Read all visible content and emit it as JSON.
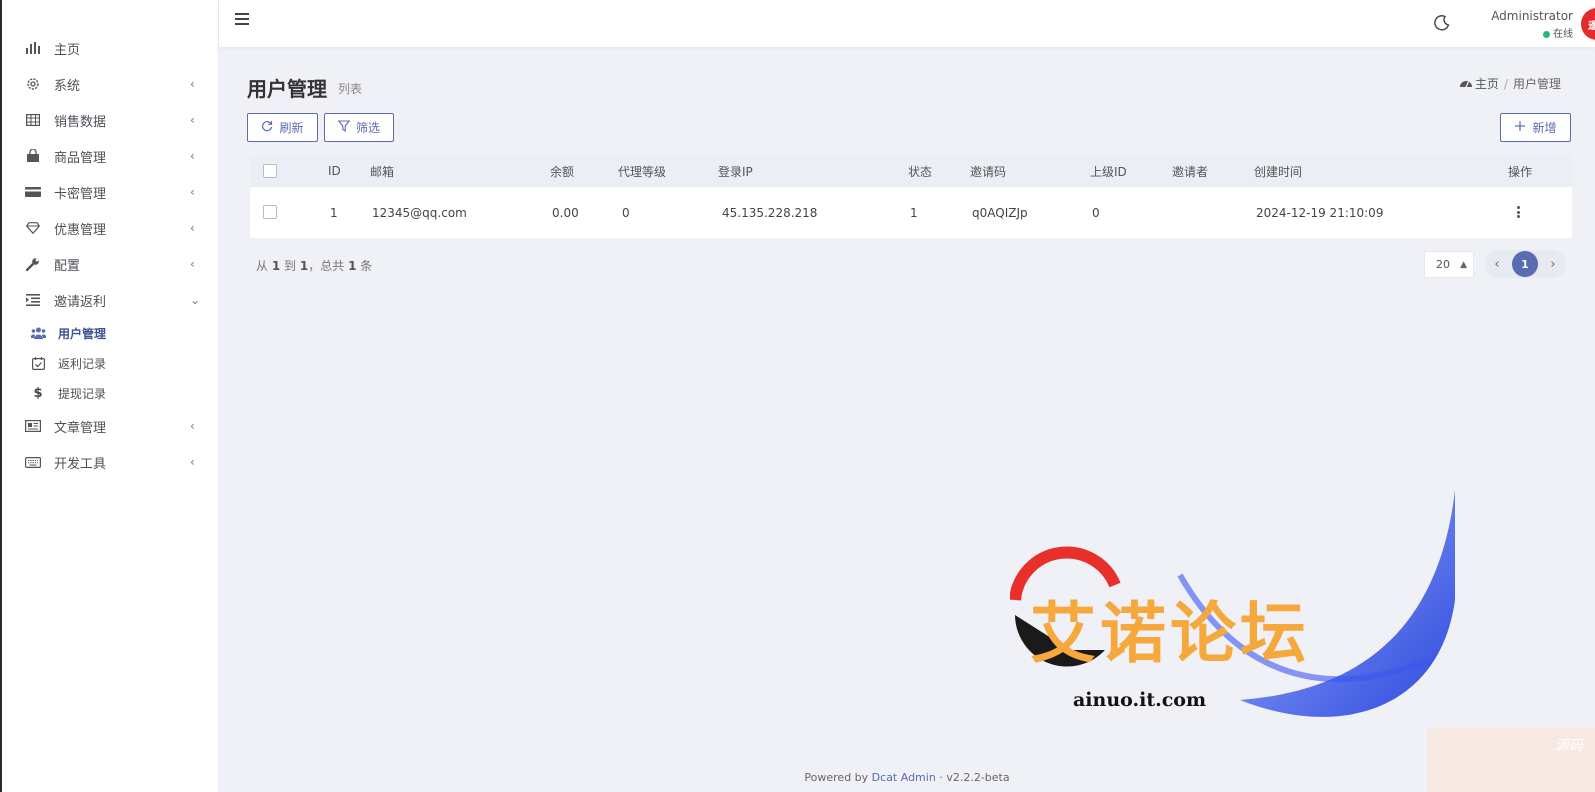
{
  "sidebar": {
    "items": [
      {
        "label": "主页",
        "icon": "bar-chart-icon",
        "has_arrow": false
      },
      {
        "label": "系统",
        "icon": "gear-icon",
        "has_arrow": true
      },
      {
        "label": "销售数据",
        "icon": "table-icon",
        "has_arrow": true
      },
      {
        "label": "商品管理",
        "icon": "shopping-bag-icon",
        "has_arrow": true
      },
      {
        "label": "卡密管理",
        "icon": "credit-card-icon",
        "has_arrow": true
      },
      {
        "label": "优惠管理",
        "icon": "diamond-icon",
        "has_arrow": true
      },
      {
        "label": "配置",
        "icon": "wrench-icon",
        "has_arrow": true
      },
      {
        "label": "邀请返利",
        "icon": "indent-list-icon",
        "has_arrow": true,
        "expanded": true
      }
    ],
    "subitems": [
      {
        "label": "用户管理",
        "icon": "users-icon",
        "active": true
      },
      {
        "label": "返利记录",
        "icon": "calendar-check-icon",
        "active": false
      },
      {
        "label": "提现记录",
        "icon": "dollar-icon",
        "active": false
      }
    ],
    "items_after": [
      {
        "label": "文章管理",
        "icon": "newspaper-icon",
        "has_arrow": true
      },
      {
        "label": "开发工具",
        "icon": "keyboard-icon",
        "has_arrow": true
      }
    ]
  },
  "header": {
    "user_name": "Administrator",
    "user_status": "在线",
    "avatar_text": "遥U",
    "status_color": "#21b978",
    "avatar_color": "#e32b2b"
  },
  "page": {
    "title": "用户管理",
    "subtitle": "列表",
    "breadcrumb": [
      "主页",
      "/",
      "用户管理"
    ]
  },
  "toolbar": {
    "refresh_label": "刷新",
    "filter_label": "筛选",
    "new_label": "新增"
  },
  "table": {
    "headers": [
      "ID",
      "邮箱",
      "余额",
      "代理等级",
      "登录IP",
      "状态",
      "邀请码",
      "上级ID",
      "邀请者",
      "创建时间",
      "操作"
    ],
    "rows": [
      {
        "id": "1",
        "email": "12345@qq.com",
        "balance": "0.00",
        "level": "0",
        "ip": "45.135.228.218",
        "status": "1",
        "code": "q0AQIZJp",
        "parent_id": "0",
        "inviter": "",
        "created": "2024-12-19 21:10:09"
      }
    ]
  },
  "pagination": {
    "summary_prefix": "从",
    "from": "1",
    "to_word": "到",
    "to": "1",
    "total_word": "，总共",
    "total": "1",
    "unit": "条",
    "per_page": "20",
    "current_page": "1"
  },
  "footer": {
    "powered_by": "Powered by",
    "link": "Dcat Admin",
    "sep": "·",
    "version": "v2.2.2-beta"
  },
  "watermark": {
    "title": "艾诺论坛",
    "url": "ainuo.it.com",
    "small": "源码"
  },
  "colors": {
    "accent": "#586cb1",
    "background": "#eff1f7"
  }
}
